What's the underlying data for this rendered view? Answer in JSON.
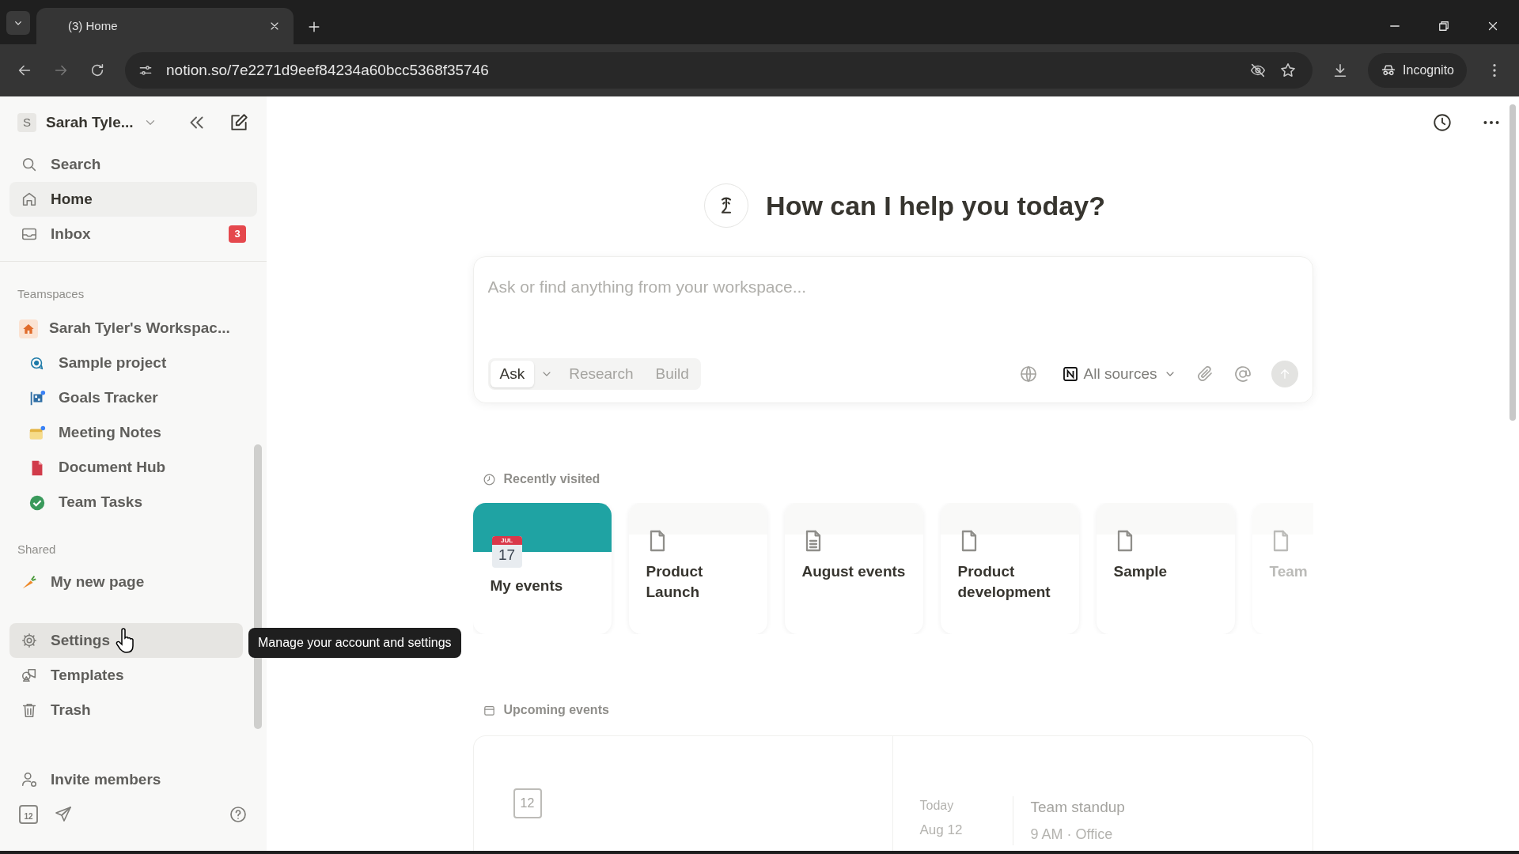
{
  "browser": {
    "tab_title": "(3) Home",
    "url": "notion.so/7e2271d9eef84234a60bcc5368f35746",
    "incognito_label": "Incognito"
  },
  "sidebar": {
    "workspace_initial": "S",
    "workspace_name": "Sarah Tyle...",
    "nav": [
      {
        "label": "Search",
        "kind": "search",
        "selected": false
      },
      {
        "label": "Home",
        "kind": "home",
        "selected": true
      },
      {
        "label": "Inbox",
        "kind": "inbox",
        "selected": false,
        "badge": "3"
      }
    ],
    "teamspaces_heading": "Teamspaces",
    "workspace": {
      "label": "Sarah Tyler's Workspac..."
    },
    "pages": [
      {
        "label": "Sample project",
        "kind": "target"
      },
      {
        "label": "Goals Tracker",
        "kind": "chart"
      },
      {
        "label": "Meeting Notes",
        "kind": "calendar"
      },
      {
        "label": "Document Hub",
        "kind": "file"
      },
      {
        "label": "Team Tasks",
        "kind": "check"
      }
    ],
    "shared_heading": "Shared",
    "shared": [
      {
        "label": "My new page",
        "kind": "carrot"
      }
    ],
    "bottom_items": [
      {
        "label": "Settings",
        "kind": "gear",
        "hovered": true
      },
      {
        "label": "Templates",
        "kind": "shapes",
        "hovered": false
      },
      {
        "label": "Trash",
        "kind": "trash",
        "hovered": false
      }
    ],
    "invite": "Invite members",
    "calendar_day": "12"
  },
  "tooltip": "Manage your account and settings",
  "main": {
    "heading": "How can I help you today?",
    "ask_box": {
      "placeholder": "Ask or find anything from your workspace...",
      "modes": [
        {
          "label": "Ask",
          "selected": true
        },
        {
          "label": "Research",
          "selected": false
        },
        {
          "label": "Build",
          "selected": false
        }
      ],
      "sources": "All sources"
    },
    "recent": {
      "heading": "Recently visited",
      "cards": [
        {
          "title": "My events",
          "kind": "cover",
          "cover_month": "JUL",
          "cover_day": "17",
          "faded": false
        },
        {
          "title": "Product Launch",
          "kind": "page",
          "faded": false
        },
        {
          "title": "August events",
          "kind": "doc",
          "faded": false
        },
        {
          "title": "Product development",
          "kind": "page",
          "faded": false
        },
        {
          "title": "Sample",
          "kind": "page",
          "faded": false
        },
        {
          "title": "Team",
          "kind": "page",
          "faded": true
        }
      ]
    },
    "upcoming": {
      "heading": "Upcoming events",
      "icon_day": "12",
      "events": [
        {
          "day": "Today",
          "date": "Aug 12",
          "title": "Team standup",
          "detail": "9 AM · Office"
        }
      ]
    }
  }
}
